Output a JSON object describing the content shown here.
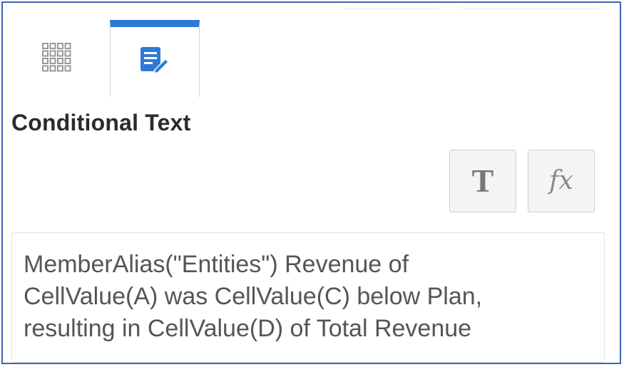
{
  "tabs": [
    {
      "icon": "grid-icon",
      "selected": false
    },
    {
      "icon": "edit-document-icon",
      "selected": true
    }
  ],
  "section": {
    "title": "Conditional Text"
  },
  "toolbar": {
    "text_button_label": "T",
    "formula_button_label": "fx"
  },
  "editor": {
    "content": "MemberAlias(\"Entities\") Revenue of\nCellValue(A) was CellValue(C) below Plan,\nresulting in CellValue(D) of Total Revenue"
  },
  "colors": {
    "accent": "#2f79d6",
    "frame_border": "#3d66b8",
    "heading_text": "#2b2b2b",
    "body_text": "#555555"
  }
}
